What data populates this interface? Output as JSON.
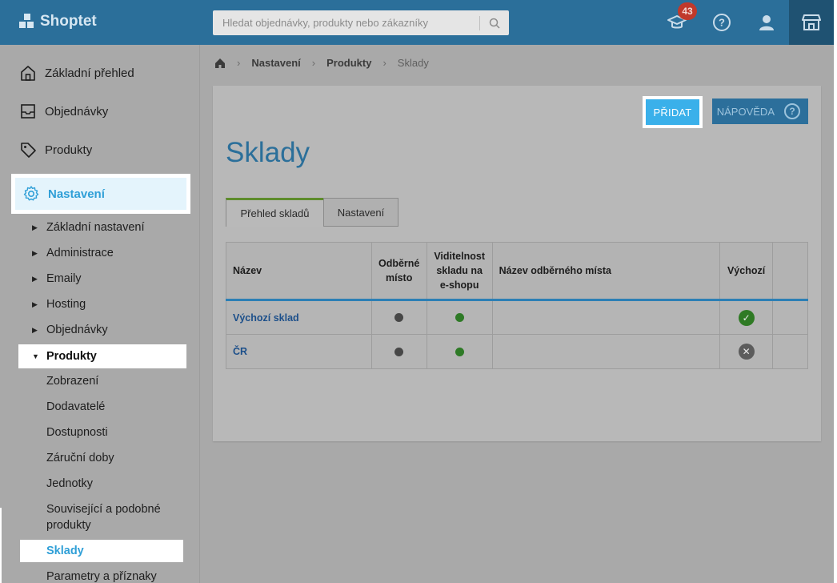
{
  "app": {
    "brand": "Shoptet"
  },
  "search": {
    "placeholder": "Hledat objednávky, produkty nebo zákazníky"
  },
  "topbar": {
    "notification_count": "43"
  },
  "sidebar": {
    "main_items": [
      {
        "label": "Základní přehled",
        "icon": "home-icon"
      },
      {
        "label": "Objednávky",
        "icon": "inbox-icon"
      },
      {
        "label": "Produkty",
        "icon": "tag-icon"
      }
    ],
    "active_section": {
      "label": "Nastavení",
      "icon": "gear-icon"
    },
    "sub_items": [
      "Základní nastavení",
      "Administrace",
      "Emaily",
      "Hosting",
      "Objednávky"
    ],
    "expanded_item": "Produkty",
    "leaf_items": [
      "Zobrazení",
      "Dodavatelé",
      "Dostupnosti",
      "Záruční doby",
      "Jednotky",
      "Související a podobné produkty"
    ],
    "active_leaf": "Sklady",
    "last_leaf": "Parametry a příznaky"
  },
  "breadcrumb": {
    "items": [
      "Nastavení",
      "Produkty",
      "Sklady"
    ]
  },
  "main": {
    "title": "Sklady",
    "add_button": "PŘIDAT",
    "help_button": "NÁPOVĚDA",
    "tabs": [
      "Přehled skladů",
      "Nastavení"
    ]
  },
  "table": {
    "headers": {
      "name": "Název",
      "pickup": "Odběrné místo",
      "visibility": "Viditelnost skladu na e-shopu",
      "pickup_name": "Název odběrného místa",
      "default": "Výchozí"
    },
    "rows": [
      {
        "name": "Výchozí sklad",
        "pickup": "no",
        "visible": "yes",
        "pickup_name": "",
        "default": "yes"
      },
      {
        "name": "ČR",
        "pickup": "no",
        "visible": "yes",
        "pickup_name": "",
        "default": "no"
      }
    ]
  },
  "colors": {
    "topbar": "#2b6f9a",
    "accent": "#3ab0ea",
    "title": "#2b6f9a",
    "ok": "#2f7a24"
  }
}
